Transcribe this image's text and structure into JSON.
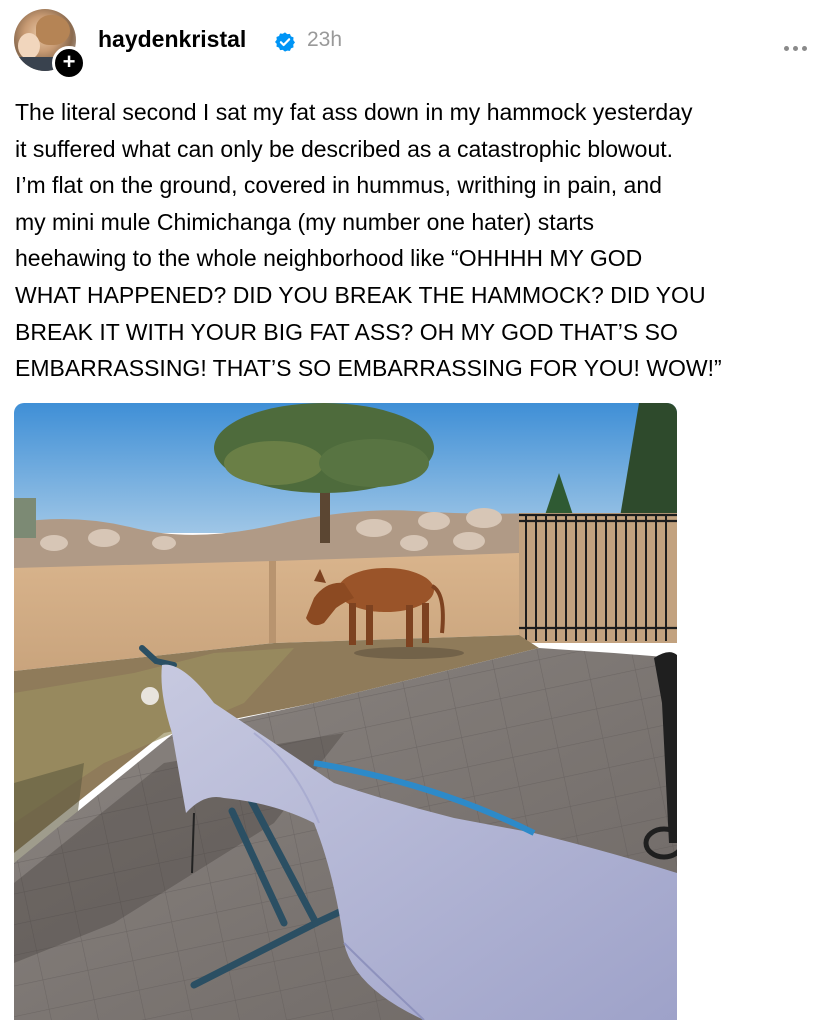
{
  "post": {
    "author": {
      "username": "haydenkristal",
      "verified": true,
      "avatar_icon": "profile-photo",
      "follow_icon": "plus-icon"
    },
    "timestamp": "23h",
    "more_icon": "more-dots-icon",
    "text": "The literal second I sat my fat ass down in my hammock yesterday\nit suffered what can only be described as a catastrophic blowout.\nI’m flat on the ground, covered in hummus, writhing in pain, and\nmy mini mule Chimichanga (my number one hater) starts\nheehawing to the whole neighborhood like “OHHHH MY GOD\nWHAT HAPPENED? DID YOU BREAK THE HAMMOCK? DID YOU\nBREAK IT WITH YOUR BIG FAT ASS? OH MY GOD THAT’S SO\nEMBARRASSING! THAT’S SO EMBARRASSING FOR YOU! WOW!”",
    "image": {
      "subject": "photo of a broken blue hammock on a stone patio with a small brown mule by a wall"
    }
  },
  "colors": {
    "verified_badge": "#0095f6",
    "timestamp": "#999999",
    "follow_badge": "#000000"
  }
}
